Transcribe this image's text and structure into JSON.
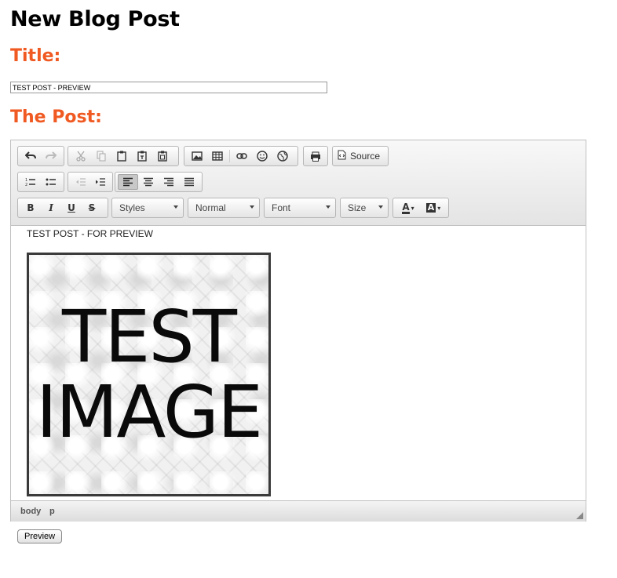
{
  "page": {
    "heading": "New Blog Post",
    "title_label": "Title:",
    "post_label": "The Post:"
  },
  "title_field": {
    "value": "TEST POST - PREVIEW"
  },
  "toolbar": {
    "source_label": "Source",
    "styles_label": "Styles",
    "format_label": "Normal",
    "font_label": "Font",
    "size_label": "Size",
    "bold_glyph": "B",
    "italic_glyph": "I",
    "underline_glyph": "U",
    "strike_glyph": "S",
    "text_color_glyph": "A",
    "bg_color_glyph": "A",
    "icons": [
      "undo-icon",
      "redo-icon",
      "cut-icon",
      "copy-icon",
      "paste-icon",
      "paste-text-icon",
      "paste-word-icon",
      "image-icon",
      "table-icon",
      "link-icon",
      "smiley-icon",
      "iframe-icon",
      "print-icon",
      "source-icon",
      "numbered-list-icon",
      "bulleted-list-icon",
      "outdent-icon",
      "indent-icon",
      "align-left-icon",
      "align-center-icon",
      "align-right-icon",
      "justify-icon"
    ]
  },
  "content": {
    "paragraph": "TEST POST  - FOR PREVIEW",
    "image_line1": "TEST",
    "image_line2": "IMAGE"
  },
  "statusbar": {
    "path": [
      "body",
      "p"
    ]
  },
  "actions": {
    "preview_label": "Preview"
  },
  "colors": {
    "label_orange": "#f05a22",
    "toolbar_bg": "#e4e4e4"
  }
}
